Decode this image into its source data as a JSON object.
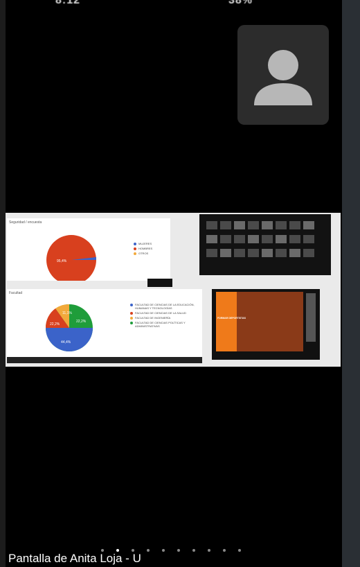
{
  "status_bar": {
    "time": "8:12",
    "battery": "38%"
  },
  "self_video": {
    "avatar": "person-avatar"
  },
  "shared_screen": {
    "slide1": {
      "title": "Seguridad / encuesta",
      "legend": [
        {
          "label": "MUJERES",
          "color": "#3b63c9"
        },
        {
          "label": "HOMBRES",
          "color": "#d8401e"
        },
        {
          "label": "OTROS",
          "color": "#f2a93b"
        }
      ],
      "slice_label": "95,4%"
    },
    "slide2": {
      "title": "Facultad",
      "legend": [
        {
          "label": "FACULTAD DE CIENCIAS DE LA EDUCACIÓN, HUMANAS Y TECNOLOGÍAS",
          "color": "#3b63c9"
        },
        {
          "label": "FACULTAD DE CIENCIAS DE LA SALUD",
          "color": "#d8401e"
        },
        {
          "label": "FACULTAD DE INGENIERÍA",
          "color": "#f2a93b"
        },
        {
          "label": "FACULTAD DE CIENCIAS POLÍTICAS Y ADMINISTRATIVAS",
          "color": "#1f9d3a"
        }
      ],
      "slice_labels": [
        "44,4%",
        "22,2%",
        "11,1%",
        "22,2%"
      ]
    },
    "video_text": "FORMAR DEPORTISTAS"
  },
  "speaker_label": "Pantalla de Anita Loja - U",
  "pager": {
    "count": 10,
    "active_index": 1
  }
}
